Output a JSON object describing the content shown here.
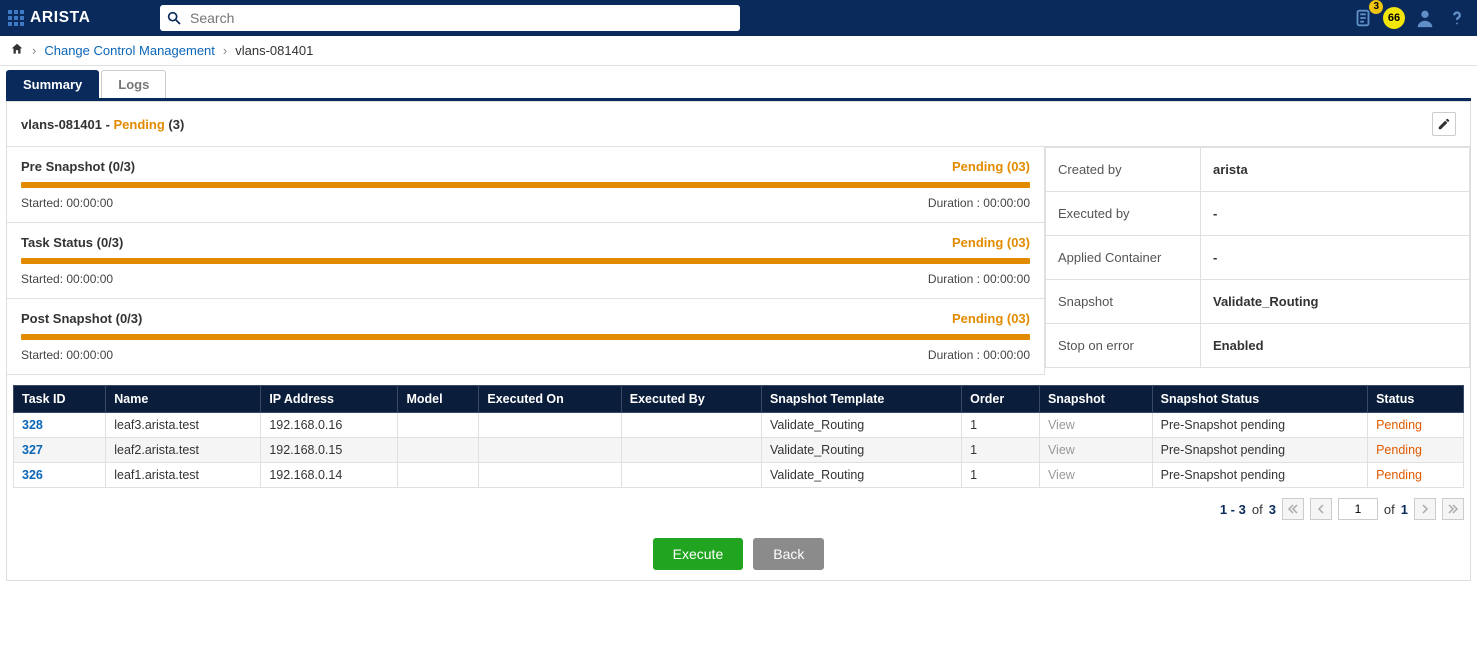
{
  "header": {
    "brand": "ARISTA",
    "search_placeholder": "Search",
    "badge1": "3",
    "badge2": "66"
  },
  "breadcrumb": {
    "link": "Change Control Management",
    "current": "vlans-081401"
  },
  "tabs": {
    "summary": "Summary",
    "logs": "Logs"
  },
  "page": {
    "name": "vlans-081401 - ",
    "status": "Pending",
    "count": " (3)"
  },
  "sections": [
    {
      "title": "Pre Snapshot (0/3)",
      "status": "Pending (03)",
      "started": "Started: 00:00:00",
      "duration": "Duration : 00:00:00"
    },
    {
      "title": "Task Status (0/3)",
      "status": "Pending (03)",
      "started": "Started: 00:00:00",
      "duration": "Duration : 00:00:00"
    },
    {
      "title": "Post Snapshot (0/3)",
      "status": "Pending (03)",
      "started": "Started: 00:00:00",
      "duration": "Duration : 00:00:00"
    }
  ],
  "info": [
    {
      "k": "Created by",
      "v": "arista"
    },
    {
      "k": "Executed by",
      "v": "-"
    },
    {
      "k": "Applied Container",
      "v": "-"
    },
    {
      "k": "Snapshot",
      "v": "Validate_Routing"
    },
    {
      "k": "Stop on error",
      "v": "Enabled"
    }
  ],
  "grid": {
    "headers": [
      "Task ID",
      "Name",
      "IP Address",
      "Model",
      "Executed On",
      "Executed By",
      "Snapshot Template",
      "Order",
      "Snapshot",
      "Snapshot Status",
      "Status"
    ],
    "rows": [
      {
        "id": "328",
        "name": "leaf3.arista.test",
        "ip": "192.168.0.16",
        "model": "",
        "exon": "",
        "exby": "",
        "tmpl": "Validate_Routing",
        "order": "1",
        "snap": "View",
        "sstat": "Pre-Snapshot pending",
        "stat": "Pending"
      },
      {
        "id": "327",
        "name": "leaf2.arista.test",
        "ip": "192.168.0.15",
        "model": "",
        "exon": "",
        "exby": "",
        "tmpl": "Validate_Routing",
        "order": "1",
        "snap": "View",
        "sstat": "Pre-Snapshot pending",
        "stat": "Pending"
      },
      {
        "id": "326",
        "name": "leaf1.arista.test",
        "ip": "192.168.0.14",
        "model": "",
        "exon": "",
        "exby": "",
        "tmpl": "Validate_Routing",
        "order": "1",
        "snap": "View",
        "sstat": "Pre-Snapshot pending",
        "stat": "Pending"
      }
    ]
  },
  "paginator": {
    "range": "1 - 3",
    "of1": "of",
    "total": "3",
    "of2": "of",
    "pages": "1",
    "cur": "1"
  },
  "buttons": {
    "execute": "Execute",
    "back": "Back"
  }
}
